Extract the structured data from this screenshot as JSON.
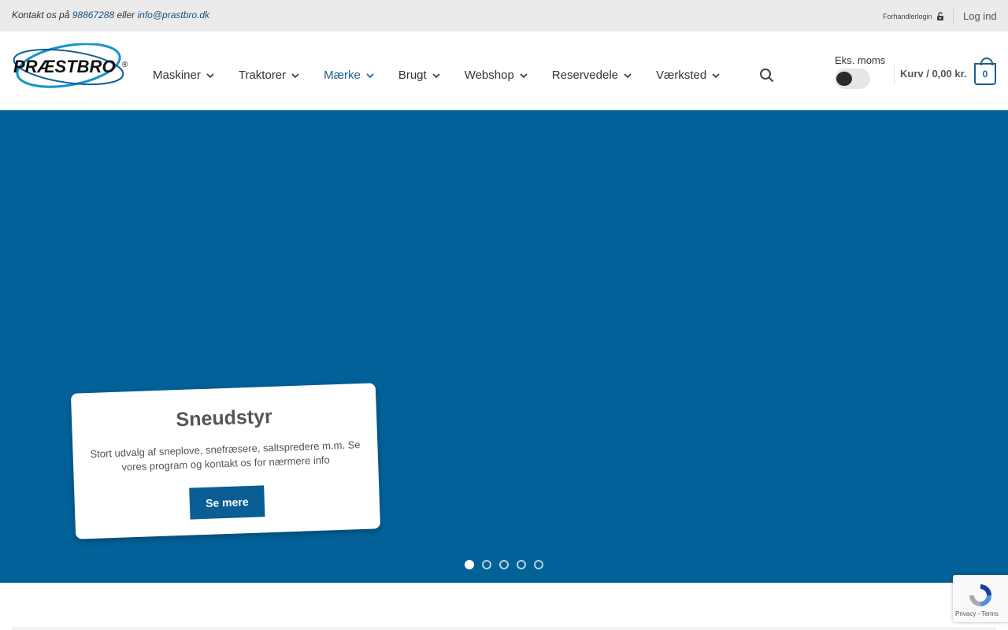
{
  "topbar": {
    "contact_prefix": "Kontakt os på",
    "phone": "98867288",
    "contact_mid": "eller",
    "email": "info@prastbro.dk",
    "dealer_login": "Forhandlerlogin",
    "login": "Log ind"
  },
  "header": {
    "logo_text": "PRÆSTBRO",
    "nav": [
      {
        "label": "Maskiner",
        "active": false
      },
      {
        "label": "Traktorer",
        "active": false
      },
      {
        "label": "Mærke",
        "active": true
      },
      {
        "label": "Brugt",
        "active": false
      },
      {
        "label": "Webshop",
        "active": false
      },
      {
        "label": "Reservedele",
        "active": false
      },
      {
        "label": "Værksted",
        "active": false
      }
    ],
    "vat_label": "Eks. moms",
    "cart_label": "Kurv / 0,00 kr.",
    "cart_count": "0"
  },
  "hero": {
    "title": "Sneudstyr",
    "text": "Stort udvalg af sneplove, snefræsere, saltspredere m.m. Se vores program og kontakt os for nærmere info",
    "button": "Se mere",
    "slide_count": 5,
    "active_slide": 1
  },
  "recaptcha": {
    "links": "Privacy - Terms"
  },
  "colors": {
    "hero_bg": "#026198",
    "accent": "#1f5e8c",
    "topbar_bg": "#ebebeb"
  }
}
